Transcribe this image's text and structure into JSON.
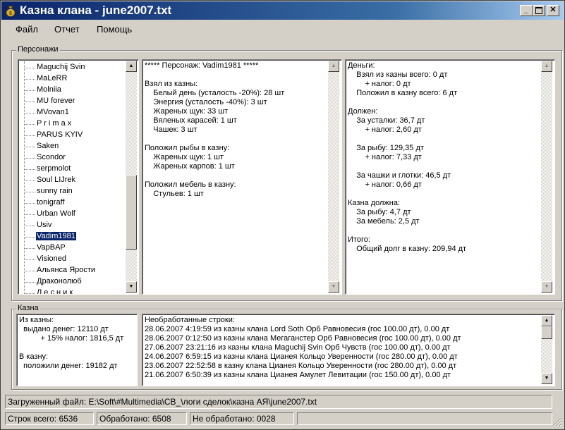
{
  "window": {
    "title": "Казна клана - june2007.txt"
  },
  "menu": {
    "file": "Файл",
    "report": "Отчет",
    "help": "Помощь"
  },
  "characters": {
    "group_label": "Персонажи",
    "list": [
      "Maguchij Svin",
      "MaLeRR",
      "Molniia",
      "MU forever",
      "MVovan1",
      "P r i m a x",
      "PARUS KYIV",
      "Saken",
      "Scondor",
      "serpmolot",
      "Soul LIJrek",
      "sunny rain",
      "tonigraff",
      "Urban Wolf",
      "Usiv",
      "Vadim1981",
      "VapBAP",
      "Visioned",
      "Альянса Ярости",
      "Драконолюб",
      "Л е с н и к"
    ],
    "selected": "Vadim1981"
  },
  "details": {
    "lines": [
      "***** Персонаж: Vadim1981 *****",
      "",
      "Взял из казны:",
      "    Белый день (усталость -20%): 28 шт",
      "    Энергия (усталость -40%): 3 шт",
      "    Жареных щук: 33 шт",
      "    Вяленых карасей: 1 шт",
      "    Чашек: 3 шт",
      "",
      "Положил рыбы в казну:",
      "    Жареных щук: 1 шт",
      "    Жареных карпов: 1 шт",
      "",
      "Положил мебель в казну:",
      "    Стульев: 1 шт"
    ]
  },
  "money": {
    "lines": [
      "Деньги:",
      "    Взял из казны всего: 0 дт",
      "        + налог: 0 дт",
      "    Положил в казну всего: 6 дт",
      "",
      "Должен:",
      "    За усталки: 36,7 дт",
      "        + налог: 2,60 дт",
      "",
      "    За рыбу: 129,35 дт",
      "        + налог: 7,33 дт",
      "",
      "    За чашки и глотки: 46,5 дт",
      "        + налог: 0,66 дт",
      "",
      "Казна должна:",
      "    За рыбу: 4,7 дт",
      "    За мебель: 2,5 дт",
      "",
      "Итого:",
      "    Общий долг в казну: 209,94 дт"
    ]
  },
  "treasury": {
    "group_label": "Казна",
    "summary": [
      "Из казны:",
      "  выдано денег: 12110 дт",
      "          + 15% налог: 1816,5 дт",
      "",
      "В казну:",
      "  положили денег: 19182 дт"
    ],
    "log": [
      "Необработанные строки:",
      "28.06.2007 4:19:59 из казны клана Lord Soth Орб Равновесия (гос 100.00 дт), 0.00 дт",
      "28.06.2007 0:12:50 из казны клана Мегаганстер Орб Равновесия (гос 100.00 дт), 0.00 дт",
      "27.06.2007 23:21:16 из казны клана Maguchij Svin Орб Чувств (гос 100.00 дт), 0.00 дт",
      "24.06.2007 6:59:15 из казны клана Цианея Кольцо Уверенности (гос 280.00 дт), 0.00 дт",
      "23.06.2007 22:52:58 в казну клана Цианея Кольцо Уверенности (гос 280.00 дт), 0.00 дт",
      "21.06.2007 6:50:39 из казны клана Цианея Амулет Левитации (гос 150.00 дт), 0.00 дт"
    ]
  },
  "status": {
    "loaded_file": "Загруженный файл: E:\\Soft\\#Multimedia\\CB_\\логи сделок\\казна АЯ\\june2007.txt",
    "total_lines": "Строк всего:  6536",
    "processed": "Обработано:  6508",
    "not_processed": "Не обработано:  0028"
  }
}
